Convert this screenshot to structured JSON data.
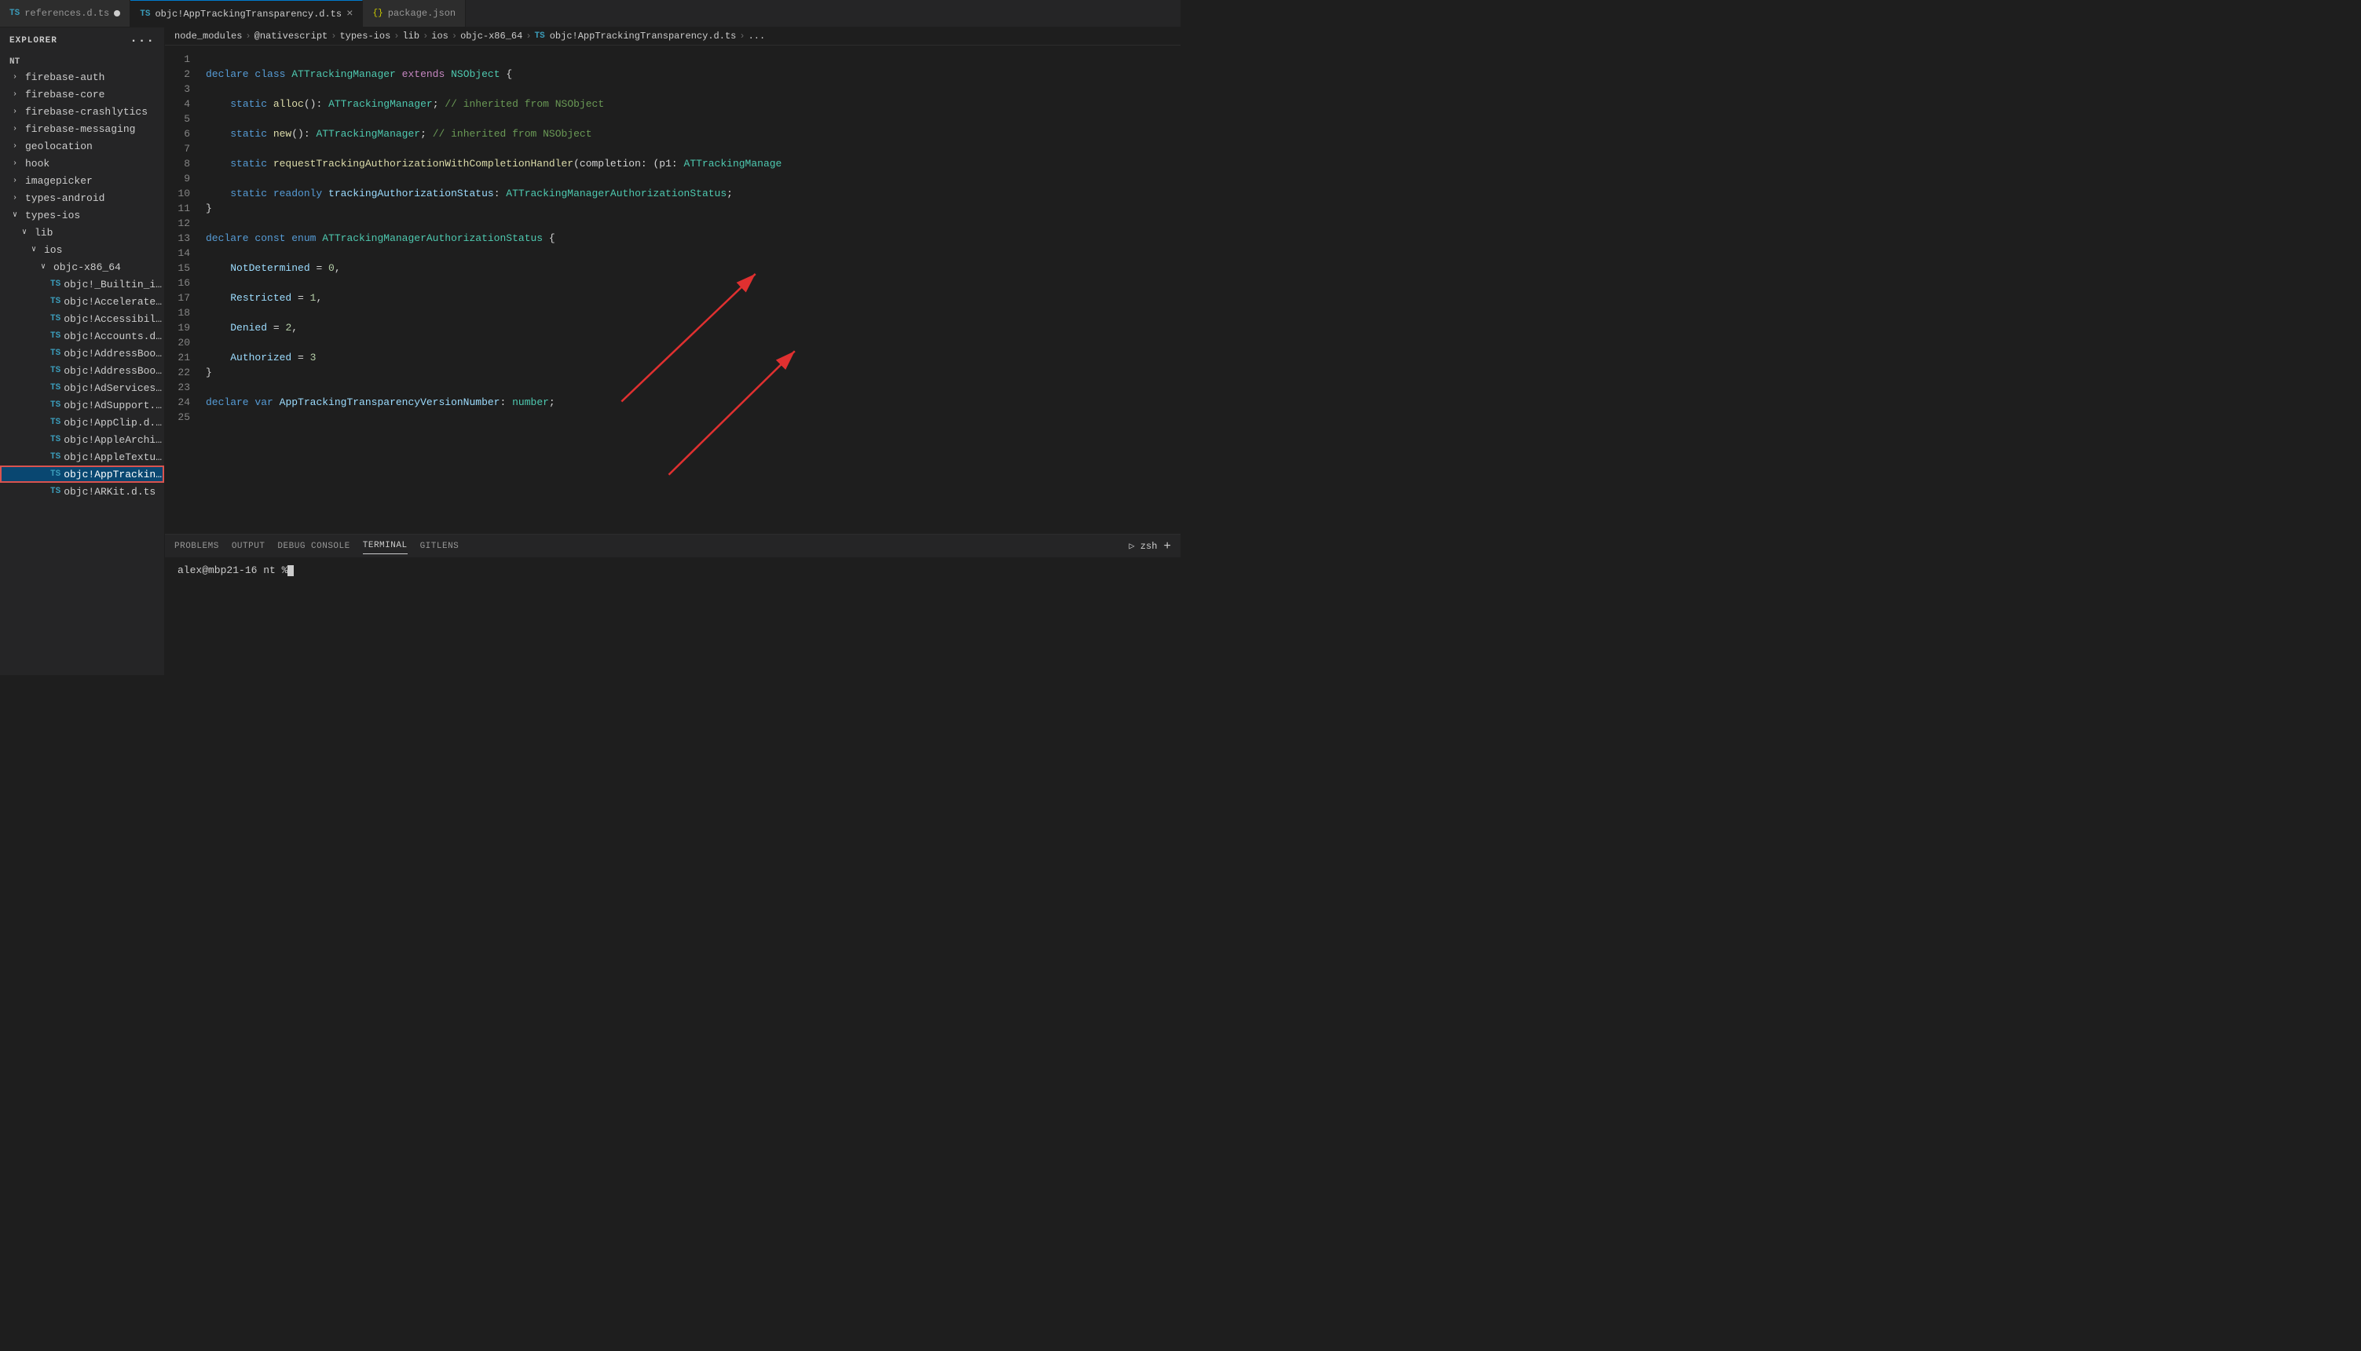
{
  "explorer": {
    "title": "EXPLORER",
    "dots": "···",
    "nt_label": "NT"
  },
  "tabs": [
    {
      "id": "references",
      "icon": "TS",
      "label": "references.d.ts",
      "modified": true,
      "active": false,
      "closeable": false
    },
    {
      "id": "apptracking",
      "icon": "TS",
      "label": "objc!AppTrackingTransparency.d.ts",
      "modified": false,
      "active": true,
      "closeable": true
    },
    {
      "id": "packagejson",
      "icon": "{}",
      "label": "package.json",
      "modified": false,
      "active": false,
      "closeable": false
    }
  ],
  "breadcrumb": {
    "parts": [
      "node_modules",
      "@nativescript",
      "types-ios",
      "lib",
      "ios",
      "objc-x86_64",
      "TS objc!AppTrackingTransparency.d.ts",
      "..."
    ]
  },
  "sidebar": {
    "items": [
      {
        "type": "folder-collapsed",
        "label": "firebase-auth",
        "indent": 1
      },
      {
        "type": "folder-collapsed",
        "label": "firebase-core",
        "indent": 1
      },
      {
        "type": "folder-collapsed",
        "label": "firebase-crashlytics",
        "indent": 1
      },
      {
        "type": "folder-collapsed",
        "label": "firebase-messaging",
        "indent": 1
      },
      {
        "type": "folder-collapsed",
        "label": "geolocation",
        "indent": 1
      },
      {
        "type": "folder-collapsed",
        "label": "hook",
        "indent": 1
      },
      {
        "type": "folder-collapsed",
        "label": "imagepicker",
        "indent": 1
      },
      {
        "type": "folder-collapsed",
        "label": "types-android",
        "indent": 1
      },
      {
        "type": "folder-open",
        "label": "types-ios",
        "indent": 1
      },
      {
        "type": "folder-open",
        "label": "lib",
        "indent": 2
      },
      {
        "type": "folder-open",
        "label": "ios",
        "indent": 3
      },
      {
        "type": "folder-open",
        "label": "objc-x86_64",
        "indent": 4
      },
      {
        "type": "ts-file",
        "label": "objc!_Builtin_intrinsics.d.ts",
        "indent": 5
      },
      {
        "type": "ts-file",
        "label": "objc!Accelerate.d.ts",
        "indent": 5
      },
      {
        "type": "ts-file",
        "label": "objc!Accessibility.d.ts",
        "indent": 5
      },
      {
        "type": "ts-file",
        "label": "objc!Accounts.d.ts",
        "indent": 5
      },
      {
        "type": "ts-file",
        "label": "objc!AddressBook.d.ts",
        "indent": 5
      },
      {
        "type": "ts-file",
        "label": "objc!AddressBookUI.d.ts",
        "indent": 5
      },
      {
        "type": "ts-file",
        "label": "objc!AdServices.d.ts",
        "indent": 5
      },
      {
        "type": "ts-file",
        "label": "objc!AdSupport.d.ts",
        "indent": 5
      },
      {
        "type": "ts-file",
        "label": "objc!AppClip.d.ts",
        "indent": 5
      },
      {
        "type": "ts-file",
        "label": "objc!AppleArchive.d.ts",
        "indent": 5
      },
      {
        "type": "ts-file",
        "label": "objc!AppleTextureEncoder.d.ts",
        "indent": 5
      },
      {
        "type": "ts-file",
        "label": "objc!AppTrackingTransparency.d.ts",
        "indent": 5,
        "active": true
      },
      {
        "type": "ts-file",
        "label": "objc!ARKit.d.ts",
        "indent": 5
      }
    ]
  },
  "code_lines": [
    {
      "num": 1,
      "content": ""
    },
    {
      "num": 2,
      "tokens": [
        {
          "t": "kw",
          "v": "declare "
        },
        {
          "t": "kw",
          "v": "class "
        },
        {
          "t": "type",
          "v": "ATTrackingManager "
        },
        {
          "t": "kw2",
          "v": "extends "
        },
        {
          "t": "type",
          "v": "NSObject "
        },
        {
          "t": "plain",
          "v": "{"
        }
      ]
    },
    {
      "num": 3,
      "content": ""
    },
    {
      "num": 4,
      "tokens": [
        {
          "t": "plain",
          "v": "    "
        },
        {
          "t": "kw",
          "v": "static "
        },
        {
          "t": "fn",
          "v": "alloc"
        },
        {
          "t": "plain",
          "v": "(): "
        },
        {
          "t": "type",
          "v": "ATTrackingManager"
        },
        {
          "t": "plain",
          "v": "; "
        },
        {
          "t": "comment",
          "v": "// inherited from NSObject"
        }
      ]
    },
    {
      "num": 5,
      "content": ""
    },
    {
      "num": 6,
      "tokens": [
        {
          "t": "plain",
          "v": "    "
        },
        {
          "t": "kw",
          "v": "static "
        },
        {
          "t": "fn",
          "v": "new"
        },
        {
          "t": "plain",
          "v": "(): "
        },
        {
          "t": "type",
          "v": "ATTrackingManager"
        },
        {
          "t": "plain",
          "v": "; "
        },
        {
          "t": "comment",
          "v": "// inherited from NSObject"
        }
      ]
    },
    {
      "num": 7,
      "content": ""
    },
    {
      "num": 8,
      "tokens": [
        {
          "t": "plain",
          "v": "    "
        },
        {
          "t": "kw",
          "v": "static "
        },
        {
          "t": "fn",
          "v": "requestTrackingAuthorizationWithCompletionHandler"
        },
        {
          "t": "plain",
          "v": "(completion: (p1: "
        },
        {
          "t": "type",
          "v": "ATTrackingManage"
        }
      ]
    },
    {
      "num": 9,
      "content": ""
    },
    {
      "num": 10,
      "tokens": [
        {
          "t": "plain",
          "v": "    "
        },
        {
          "t": "kw",
          "v": "static "
        },
        {
          "t": "kw",
          "v": "readonly "
        },
        {
          "t": "prop",
          "v": "trackingAuthorizationStatus"
        },
        {
          "t": "plain",
          "v": ": "
        },
        {
          "t": "type",
          "v": "ATTrackingManagerAuthorizationStatus"
        },
        {
          "t": "plain",
          "v": ";"
        }
      ]
    },
    {
      "num": 11,
      "tokens": [
        {
          "t": "plain",
          "v": "}"
        }
      ]
    },
    {
      "num": 12,
      "content": ""
    },
    {
      "num": 13,
      "tokens": [
        {
          "t": "kw",
          "v": "declare "
        },
        {
          "t": "kw",
          "v": "const "
        },
        {
          "t": "kw",
          "v": "enum "
        },
        {
          "t": "type",
          "v": "ATTrackingManagerAuthorizationStatus "
        },
        {
          "t": "plain",
          "v": "{"
        }
      ]
    },
    {
      "num": 14,
      "content": ""
    },
    {
      "num": 15,
      "tokens": [
        {
          "t": "plain",
          "v": "    "
        },
        {
          "t": "prop",
          "v": "NotDetermined "
        },
        {
          "t": "plain",
          "v": "= "
        },
        {
          "t": "num",
          "v": "0"
        },
        {
          "t": "plain",
          "v": ","
        }
      ]
    },
    {
      "num": 16,
      "content": ""
    },
    {
      "num": 17,
      "tokens": [
        {
          "t": "plain",
          "v": "    "
        },
        {
          "t": "prop",
          "v": "Restricted "
        },
        {
          "t": "plain",
          "v": "= "
        },
        {
          "t": "num",
          "v": "1"
        },
        {
          "t": "plain",
          "v": ","
        }
      ]
    },
    {
      "num": 18,
      "content": ""
    },
    {
      "num": 19,
      "tokens": [
        {
          "t": "plain",
          "v": "    "
        },
        {
          "t": "prop",
          "v": "Denied "
        },
        {
          "t": "plain",
          "v": "= "
        },
        {
          "t": "num",
          "v": "2"
        },
        {
          "t": "plain",
          "v": ","
        }
      ]
    },
    {
      "num": 20,
      "content": ""
    },
    {
      "num": 21,
      "tokens": [
        {
          "t": "plain",
          "v": "    "
        },
        {
          "t": "prop",
          "v": "Authorized "
        },
        {
          "t": "plain",
          "v": "= "
        },
        {
          "t": "num",
          "v": "3"
        }
      ]
    },
    {
      "num": 22,
      "tokens": [
        {
          "t": "plain",
          "v": "}"
        }
      ]
    },
    {
      "num": 23,
      "content": ""
    },
    {
      "num": 24,
      "tokens": [
        {
          "t": "kw",
          "v": "declare "
        },
        {
          "t": "kw",
          "v": "var "
        },
        {
          "t": "prop",
          "v": "AppTrackingTransparencyVersionNumber"
        },
        {
          "t": "plain",
          "v": ": "
        },
        {
          "t": "type",
          "v": "number"
        },
        {
          "t": "plain",
          "v": ";"
        }
      ]
    },
    {
      "num": 25,
      "content": ""
    }
  ],
  "panel": {
    "tabs": [
      "PROBLEMS",
      "OUTPUT",
      "DEBUG CONSOLE",
      "TERMINAL",
      "GITLENS"
    ],
    "active_tab": "TERMINAL",
    "right_label": "zsh",
    "plus_label": "+",
    "terminal_text": "alex@mbp21-16 nt % "
  }
}
